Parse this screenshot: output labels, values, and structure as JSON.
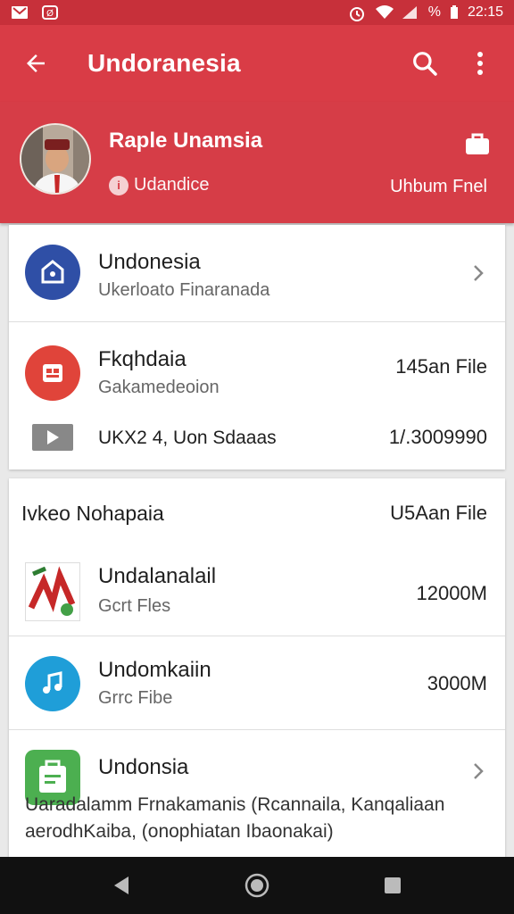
{
  "status_bar": {
    "battery_text": "%",
    "time": "22:15"
  },
  "app_bar": {
    "title": "Undoranesia"
  },
  "profile": {
    "name": "Raple Unamsia",
    "subtitle": "Udandice",
    "action": "Uhbum Fnel"
  },
  "card1": {
    "row1": {
      "title": "Undonesia",
      "subtitle": "Ukerloato Finaranada"
    },
    "row2": {
      "title": "Fkqhdaia",
      "subtitle": "Gakamedeoion",
      "right": "145an File"
    },
    "row3": {
      "title": "UKX2 4, Uon Sdaaas",
      "right": "1/.3009990"
    }
  },
  "card2": {
    "header": {
      "title": "Ivkeo Nohapaia",
      "right": "U5Aan File"
    },
    "row1": {
      "title": "Undalanalail",
      "subtitle": "Gcrt Fles",
      "right": "12000M"
    },
    "row2": {
      "title": "Undomkaiin",
      "subtitle": "Grrc Fibe",
      "right": "3000M"
    },
    "row3": {
      "title": "Undonsia",
      "line1": "Uaradalamm Frnakamanis (Rcannaila, Kanqaliaan",
      "line2": "aerodhKaiba, (onophiatan Ibaonakai)"
    }
  },
  "colors": {
    "primary": "#d93c46",
    "status_bar": "#c7303a",
    "blue_icon": "#2f4fa6",
    "red_icon": "#e0443a",
    "music_icon": "#1f9ed8",
    "green_icon": "#4caf50"
  }
}
